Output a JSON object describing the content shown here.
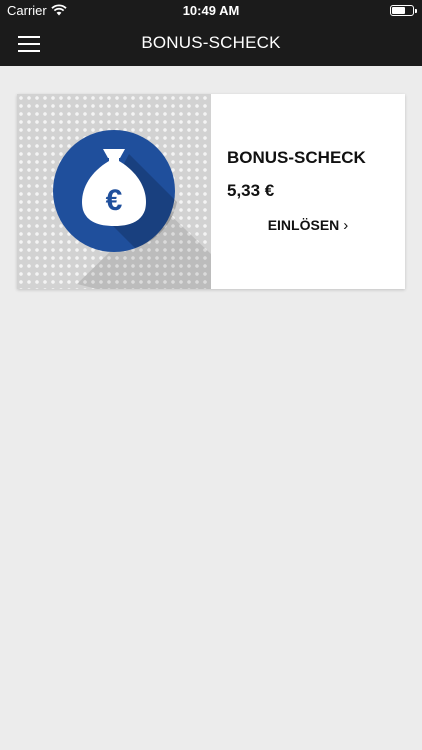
{
  "status_bar": {
    "carrier": "Carrier",
    "time": "10:49 AM"
  },
  "nav": {
    "title": "BONUS-SCHECK"
  },
  "card": {
    "title": "BONUS-SCHECK",
    "amount": "5,33 €",
    "redeem_label": "EINLÖSEN",
    "icon_symbol": "€"
  },
  "colors": {
    "header_bg": "#1b1b1b",
    "accent_blue": "#1f4f9c",
    "background": "#ececec"
  }
}
